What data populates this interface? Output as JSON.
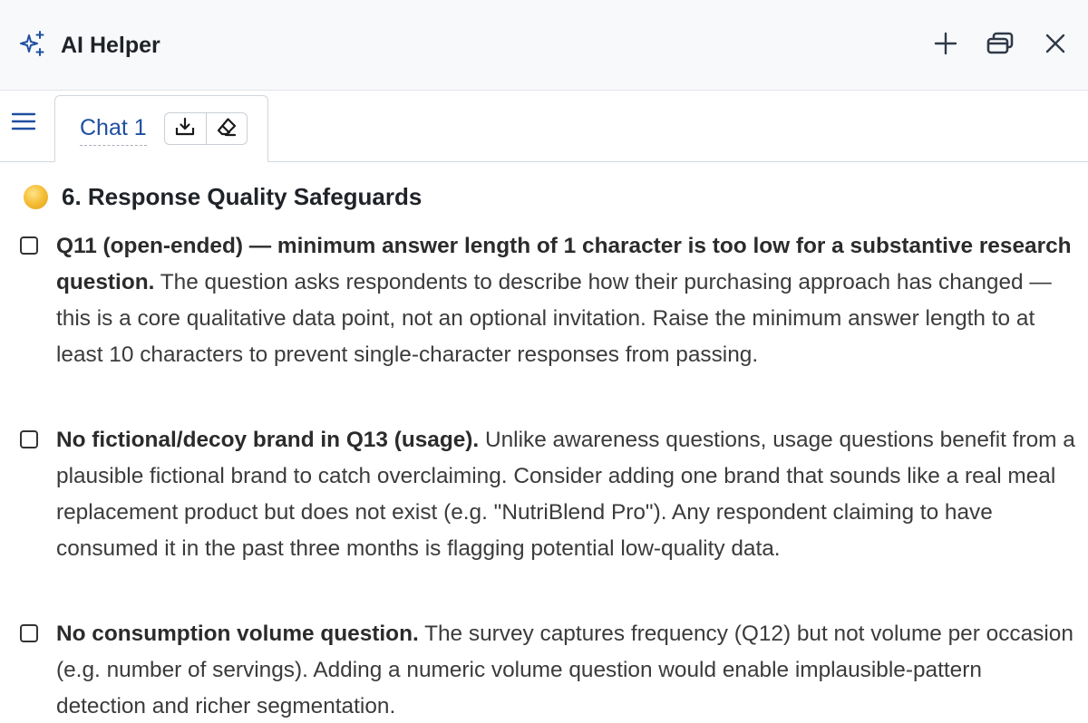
{
  "window": {
    "title": "AI Helper",
    "app_icon": "sparkles-icon",
    "buttons": [
      "plus-icon",
      "restore-window-icon",
      "close-icon"
    ]
  },
  "tabs": [
    {
      "label": "Chat 1",
      "actions": [
        "download-icon",
        "eraser-icon"
      ]
    }
  ],
  "section": {
    "title": "6. Response Quality Safeguards",
    "icon_color": "#f3b52b"
  },
  "items": [
    {
      "bold": "Q11 (open-ended) — minimum answer length of 1 character is too low for a substantive research question.",
      "text": " The question asks respondents to describe how their purchasing approach has changed — this is a core qualitative data point, not an optional invitation. Raise the minimum answer length to at least 10 characters to prevent single-character responses from passing.",
      "checked": false
    },
    {
      "bold": "No fictional/decoy brand in Q13 (usage).",
      "text": " Unlike awareness questions, usage questions benefit from a plausible fictional brand to catch overclaiming. Consider adding one brand that sounds like a real meal replacement product but does not exist (e.g. \"NutriBlend Pro\"). Any respondent claiming to have consumed it in the past three months is flagging potential low-quality data.",
      "checked": false
    },
    {
      "bold": "No consumption volume question.",
      "text": " The survey captures frequency (Q12) but not volume per occasion (e.g. number of servings). Adding a numeric volume question would enable implausible-pattern detection and richer segmentation.",
      "checked": false
    }
  ],
  "colors": {
    "accent": "#1f4fa0",
    "titlebar_bg": "#f8f9fb"
  }
}
